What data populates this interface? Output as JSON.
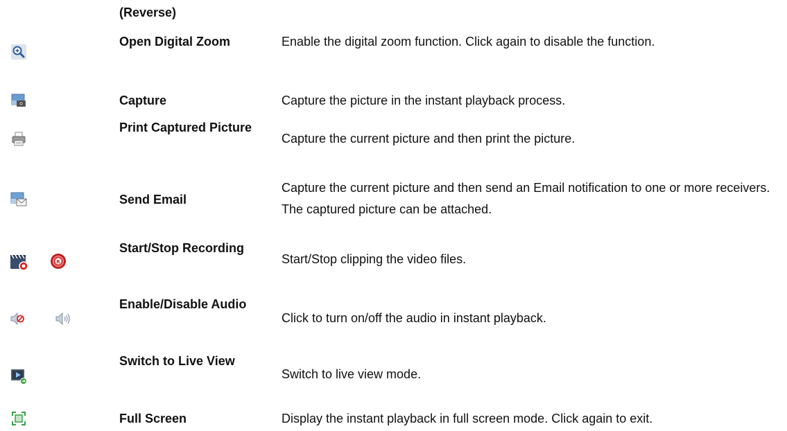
{
  "rows": [
    {
      "name": "(Reverse)",
      "desc": "",
      "icons": []
    },
    {
      "name": "Open Digital Zoom",
      "desc": "Enable the digital zoom function. Click again to disable the function.",
      "icons": [
        "zoom-in-icon"
      ]
    },
    {
      "name": "Capture",
      "desc": "Capture the picture in the instant playback process.",
      "icons": [
        "camera-icon"
      ]
    },
    {
      "name": "Print Captured Picture",
      "desc": "Capture the current picture and then print the picture.",
      "icons": [
        "printer-icon"
      ]
    },
    {
      "name": "Send Email",
      "desc": "Capture the current picture and then send an Email notification to one or more receivers. The captured picture can be attached.",
      "icons": [
        "email-picture-icon"
      ]
    },
    {
      "name": "Start/Stop Recording",
      "desc": "Start/Stop clipping the video files.",
      "icons": [
        "clapper-record-icon",
        "record-r-icon"
      ]
    },
    {
      "name": "Enable/Disable Audio",
      "desc": "Click to turn on/off the audio in instant playback.",
      "icons": [
        "audio-muted-icon",
        "audio-on-icon"
      ]
    },
    {
      "name": "Switch to Live View",
      "desc": "Switch to live view mode.",
      "icons": [
        "live-view-icon"
      ]
    },
    {
      "name": "Full Screen",
      "desc": "Display the instant playback in full screen mode. Click again to exit.",
      "icons": [
        "full-screen-icon"
      ]
    }
  ]
}
